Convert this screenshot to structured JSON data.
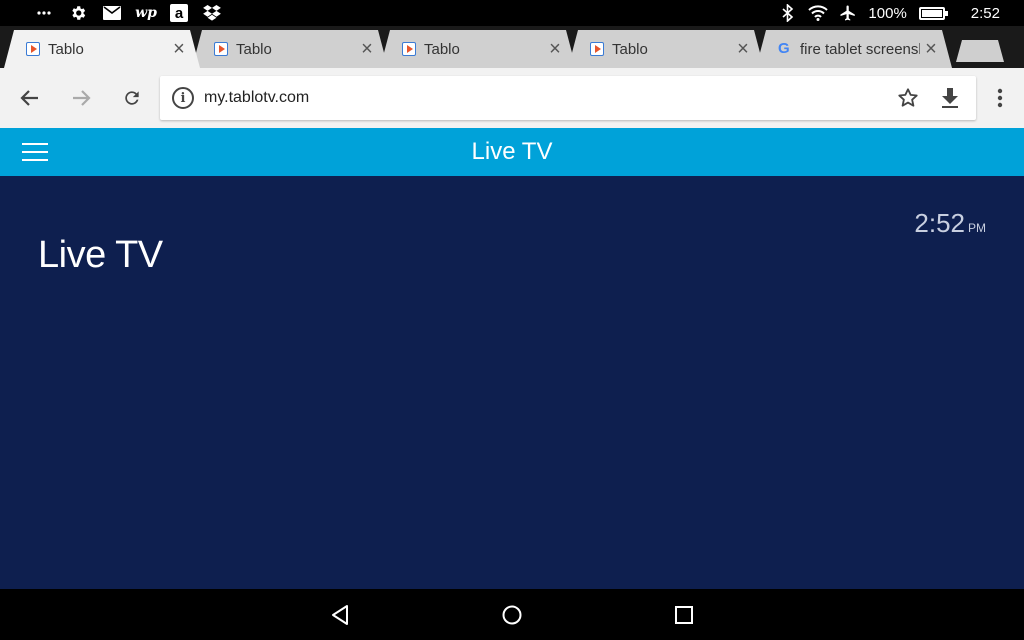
{
  "status_bar": {
    "left_icons": [
      "more-icon",
      "gear-icon",
      "mail-icon",
      "washington-post-icon",
      "amazon-icon",
      "dropbox-icon"
    ],
    "wapo_glyph": "wp",
    "amazon_glyph": "a",
    "right_icons": [
      "bluetooth-icon",
      "wifi-icon",
      "airplane-icon"
    ],
    "battery_percent": "100%",
    "battery_level": 1.0,
    "time": "2:52"
  },
  "tabs": [
    {
      "title": "Tablo",
      "active": true,
      "favicon": "tablo-icon"
    },
    {
      "title": "Tablo",
      "active": false,
      "favicon": "tablo-icon"
    },
    {
      "title": "Tablo",
      "active": false,
      "favicon": "tablo-icon"
    },
    {
      "title": "Tablo",
      "active": false,
      "favicon": "tablo-icon"
    },
    {
      "title": "fire tablet screenshot",
      "active": false,
      "favicon": "google-icon",
      "favicon_glyph": "G"
    }
  ],
  "tab_close_glyph": "×",
  "toolbar": {
    "url": "my.tablotv.com",
    "info_glyph": "i"
  },
  "web_header": {
    "title": "Live TV"
  },
  "content": {
    "title": "Live TV",
    "time": "2:52",
    "ampm": "PM"
  },
  "colors": {
    "header_blue": "#00a2d9",
    "content_navy": "#0e1f4f"
  }
}
